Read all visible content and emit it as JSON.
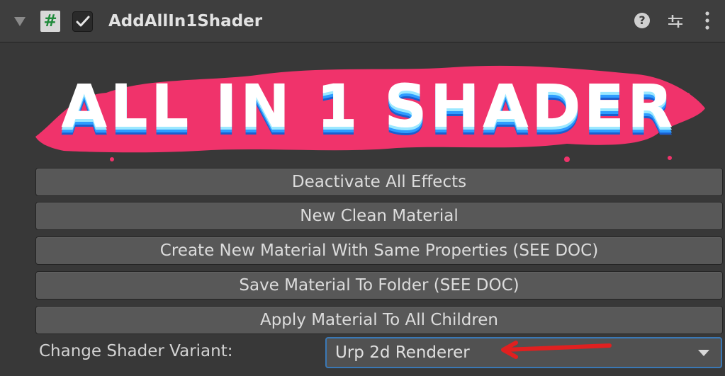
{
  "component": {
    "title": "AddAllIn1Shader",
    "script_icon": "#",
    "enabled": true
  },
  "banner": {
    "text": "ALL IN 1 SHADER",
    "splash_color": "#f0336b"
  },
  "buttons": [
    {
      "label": "Deactivate All Effects"
    },
    {
      "label": "New Clean Material"
    },
    {
      "label": "Create New Material With Same Properties (SEE DOC)"
    },
    {
      "label": "Save Material To Folder (SEE DOC)"
    },
    {
      "label": "Apply Material To All Children"
    }
  ],
  "shader_variant": {
    "label": "Change Shader Variant:",
    "value": "Urp 2d Renderer"
  },
  "icons": {
    "help": "?",
    "annotation_color": "#e02020"
  }
}
